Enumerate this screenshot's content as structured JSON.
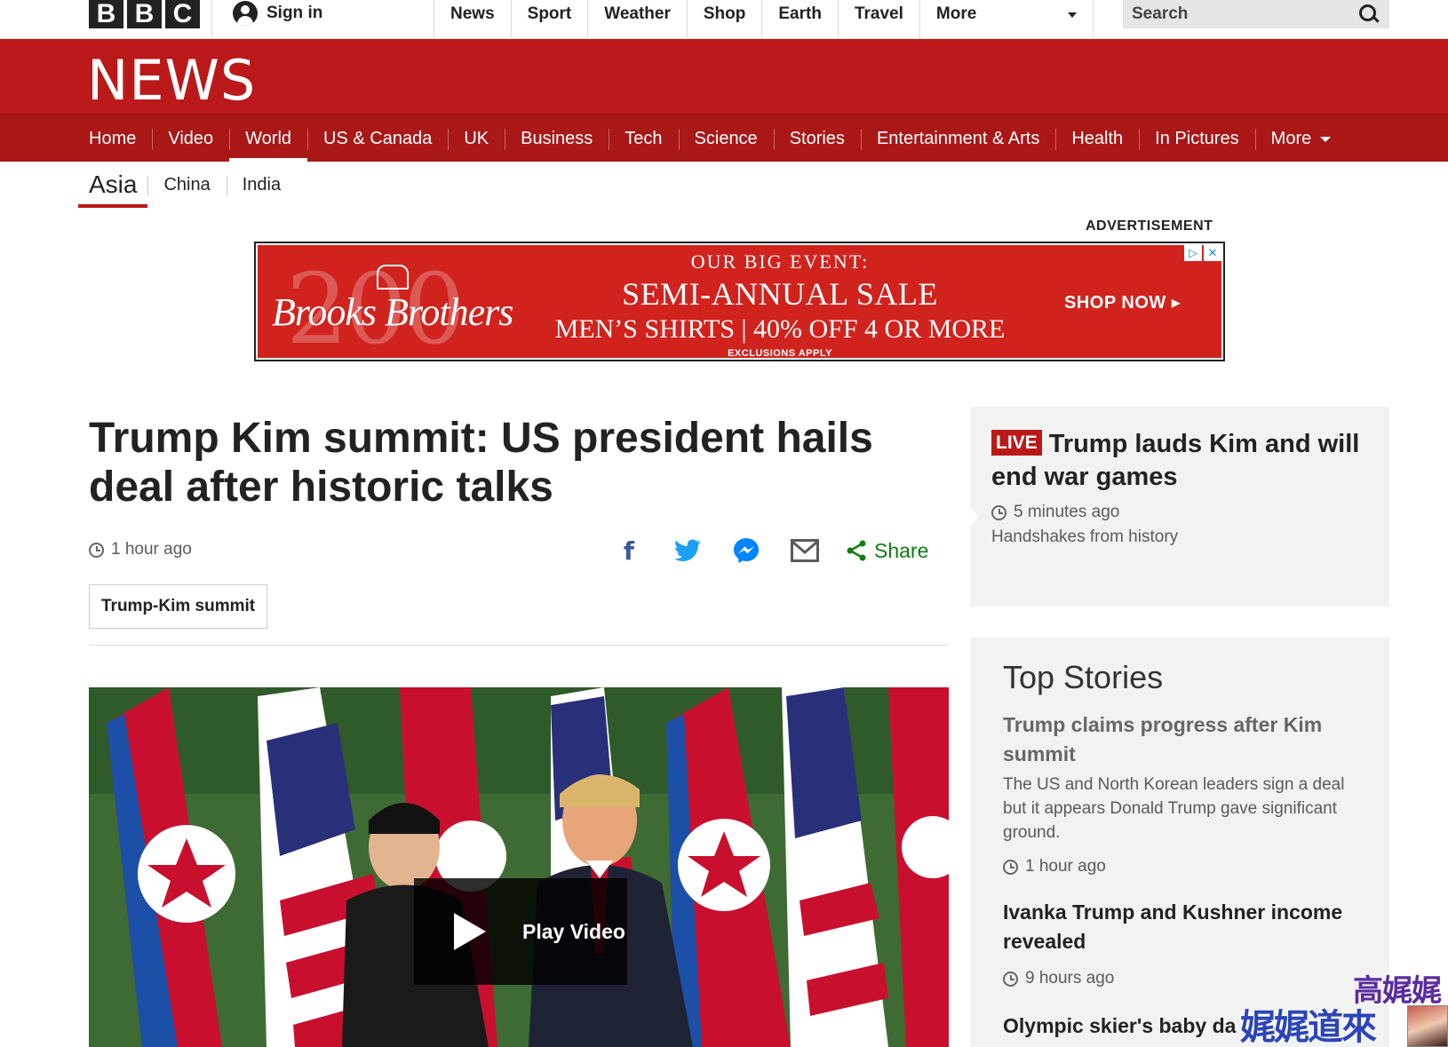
{
  "topbar": {
    "logo_letters": [
      "B",
      "B",
      "C"
    ],
    "sign_in": "Sign in",
    "nav": [
      "News",
      "Sport",
      "Weather",
      "Shop",
      "Earth",
      "Travel"
    ],
    "more": "More",
    "search_placeholder": "Search"
  },
  "masthead": {
    "title": "NEWS"
  },
  "mainnav": {
    "items": [
      "Home",
      "Video",
      "World",
      "US & Canada",
      "UK",
      "Business",
      "Tech",
      "Science",
      "Stories",
      "Entertainment & Arts",
      "Health",
      "In Pictures"
    ],
    "active": "World",
    "more": "More"
  },
  "subnav": {
    "items": [
      "Asia",
      "China",
      "India"
    ],
    "active": "Asia"
  },
  "advertisement": {
    "label": "ADVERTISEMENT",
    "logo_number": "200",
    "logo_text": "Brooks Brothers",
    "eyebrow": "OUR BIG EVENT:",
    "headline": "SEMI-ANNUAL SALE",
    "subline": "MEN’S SHIRTS | 40% OFF 4 OR MORE",
    "fine_print": "EXCLUSIONS APPLY",
    "cta": "SHOP NOW ▸",
    "adchoices": "▷",
    "close": "✕"
  },
  "article": {
    "headline": "Trump Kim summit: US president hails deal after historic talks",
    "time": "1 hour ago",
    "share_label": "Share",
    "tag": "Trump-Kim summit",
    "video_label": "Play Video"
  },
  "live": {
    "badge": "LIVE",
    "headline": "Trump lauds Kim and will end war games",
    "time": "5 minutes ago",
    "summary": "Handshakes from history"
  },
  "top_stories": {
    "title": "Top Stories",
    "stories": [
      {
        "headline": "Trump claims progress after Kim summit",
        "summary": "The US and North Korean leaders sign a deal but it appears Donald Trump gave significant ground.",
        "time": "1 hour ago"
      },
      {
        "headline": "Ivanka Trump and Kushner income revealed",
        "time": "9 hours ago"
      },
      {
        "headline": "Olympic skier's baby da"
      }
    ]
  },
  "watermark": {
    "top": "高娓娓",
    "bottom": "娓娓道來"
  },
  "colors": {
    "bbc_red": "#bb1919",
    "nav_red": "#a91717",
    "share_green": "#107c10",
    "sidebar_bg": "#f2f2f2"
  }
}
